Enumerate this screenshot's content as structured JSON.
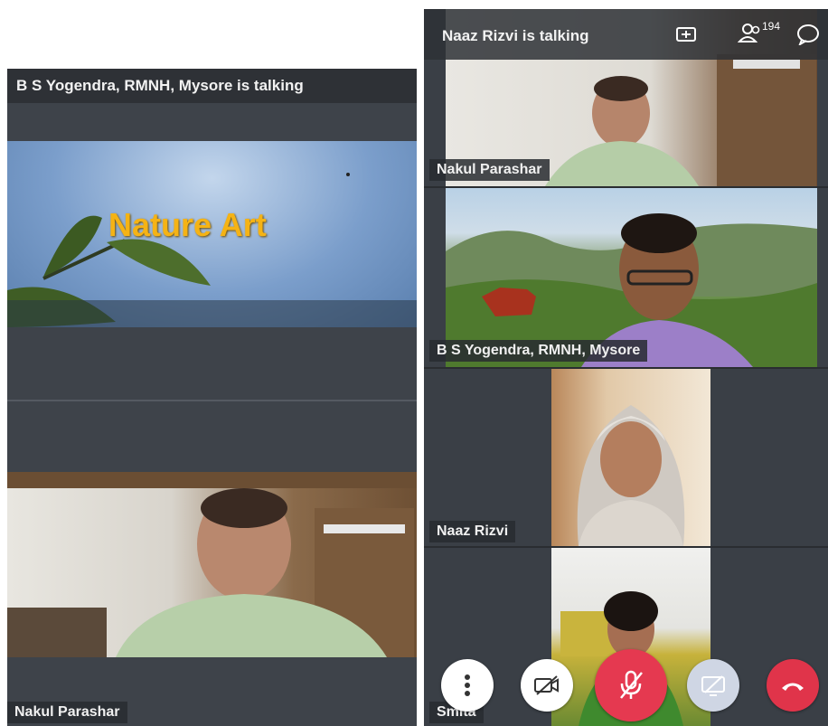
{
  "left": {
    "talking": "B S Yogendra, RMNH, Mysore is talking",
    "slide_title": "Nature Art",
    "participant_name": "Nakul Parashar"
  },
  "right": {
    "talking": "Naaz Rizvi is talking",
    "participant_count": "194",
    "tiles": [
      {
        "name": "Nakul Parashar"
      },
      {
        "name": "B S Yogendra, RMNH, Mysore"
      },
      {
        "name": "Naaz Rizvi"
      },
      {
        "name": "Smita"
      }
    ],
    "icons": {
      "rotate": "screen-rotate-icon",
      "participants": "participants-icon",
      "chat": "chat-icon",
      "more": "more-options-icon",
      "camera": "camera-off-icon",
      "mic": "mic-off-icon",
      "screen": "screen-share-icon",
      "hangup": "hang-up-icon"
    }
  },
  "colors": {
    "mute_red": "#e53950",
    "hangup_red": "#e0344a",
    "slide_title": "#f5b315"
  }
}
